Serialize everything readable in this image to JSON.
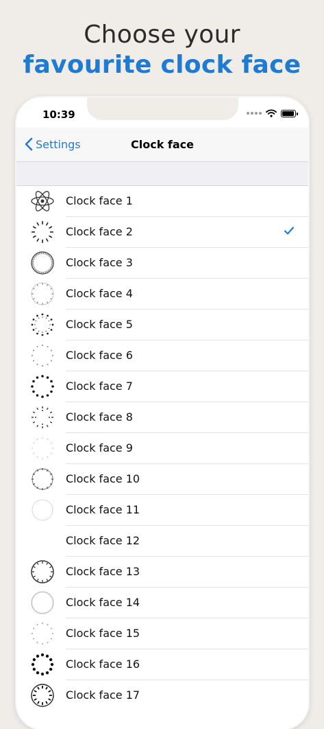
{
  "headline": {
    "line1": "Choose your",
    "line2": "favourite clock face"
  },
  "status_bar": {
    "time": "10:39",
    "icons": [
      "cellular-signal-icon",
      "wifi-icon",
      "battery-icon"
    ]
  },
  "nav": {
    "back_label": "Settings",
    "title": "Clock face"
  },
  "colors": {
    "accent": "#1f7bd1",
    "background": "#f0ede9"
  },
  "clock_faces": [
    {
      "label": "Clock face 1",
      "icon": "atom-icon",
      "selected": false
    },
    {
      "label": "Clock face 2",
      "icon": "clock-ticks-icon",
      "selected": true
    },
    {
      "label": "Clock face 3",
      "icon": "clock-dial-icon",
      "selected": false
    },
    {
      "label": "Clock face 4",
      "icon": "clock-thin-dial-icon",
      "selected": false
    },
    {
      "label": "Clock face 5",
      "icon": "clock-numerals-icon",
      "selected": false
    },
    {
      "label": "Clock face 6",
      "icon": "clock-light-numerals-icon",
      "selected": false
    },
    {
      "label": "Clock face 7",
      "icon": "clock-dots-icon",
      "selected": false
    },
    {
      "label": "Clock face 8",
      "icon": "clock-mixed-icon",
      "selected": false
    },
    {
      "label": "Clock face 9",
      "icon": "clock-faint-dots-icon",
      "selected": false
    },
    {
      "label": "Clock face 10",
      "icon": "clock-minute-ring-icon",
      "selected": false
    },
    {
      "label": "Clock face 11",
      "icon": "clock-faint-ring-icon",
      "selected": false
    },
    {
      "label": "Clock face 12",
      "icon": "",
      "selected": false
    },
    {
      "label": "Clock face 13",
      "icon": "clock-bold-ring-icon",
      "selected": false
    },
    {
      "label": "Clock face 14",
      "icon": "clock-fine-ring-icon",
      "selected": false
    },
    {
      "label": "Clock face 15",
      "icon": "clock-sparse-numerals-icon",
      "selected": false
    },
    {
      "label": "Clock face 16",
      "icon": "clock-large-numerals-icon",
      "selected": false
    },
    {
      "label": "Clock face 17",
      "icon": "clock-roman-ring-icon",
      "selected": false
    }
  ]
}
